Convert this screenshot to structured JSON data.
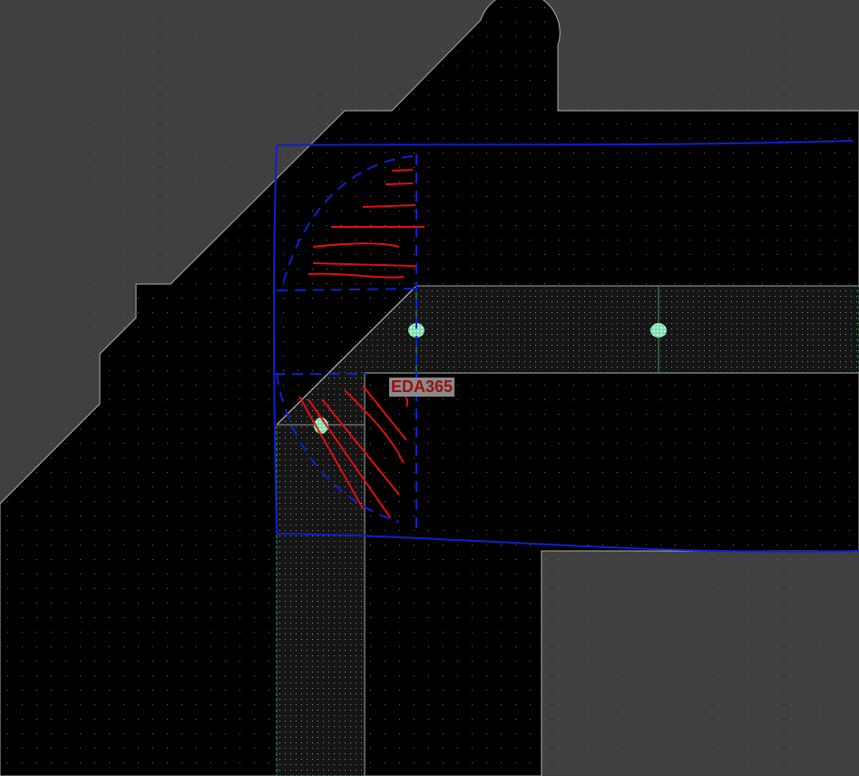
{
  "editor": {
    "net_label": "EDA365",
    "colors": {
      "board_background": "#404040",
      "copper_pour": "#000000",
      "trace_outline": "#2e8b57",
      "via": "#7fe0b0",
      "annotation_blue": "#1020d0",
      "annotation_red": "#e01010",
      "label_text": "#9b1010"
    }
  }
}
